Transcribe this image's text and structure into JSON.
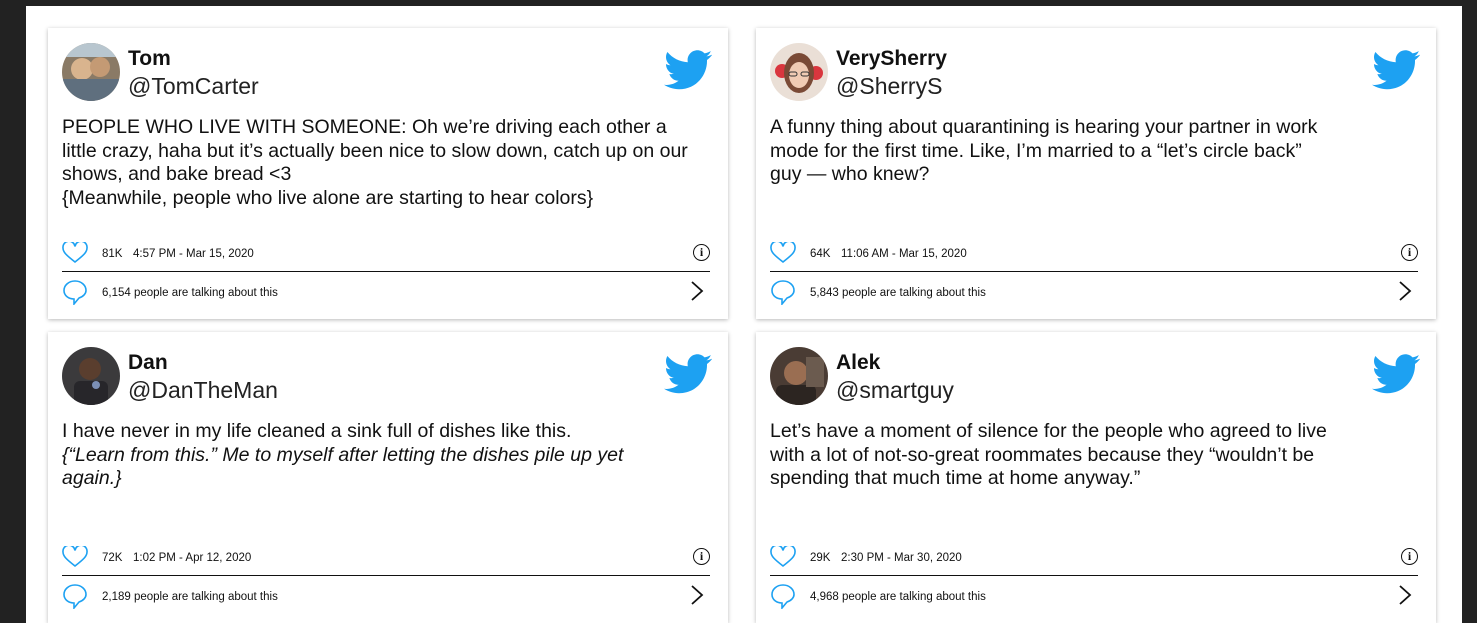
{
  "accent_color": "#1da1f2",
  "icons": {
    "twitter": "twitter-bird-icon",
    "like": "heart-icon",
    "info": "info-icon",
    "reply": "speech-bubble-icon",
    "more": "chevron-right-icon"
  },
  "tweets": [
    {
      "name": "Tom",
      "handle": "@TomCarter",
      "text": "PEOPLE WHO LIVE WITH SOMEONE: Oh we’re driving each other a little crazy, haha but it’s actually been nice to slow down, catch up on our shows, and bake bread <3",
      "text2": "{Meanwhile, people who live alone are starting to hear colors}",
      "likes": "81K",
      "timestamp": "4:57 PM - Mar 15, 2020",
      "talking": "6,154 people are talking about this",
      "info_glyph": "i"
    },
    {
      "name": "VerySherry",
      "handle": "@SherryS",
      "text": "A funny thing about quarantining is hearing your partner in work mode for the first time. Like, I’m married to a “let’s circle back” guy — who knew?",
      "text2": "",
      "likes": "64K",
      "timestamp": "11:06 AM - Mar 15, 2020",
      "talking": "5,843 people are talking about this",
      "info_glyph": "i"
    },
    {
      "name": "Dan",
      "handle": "@DanTheMan",
      "text": "I have never in my life cleaned a sink full of dishes like this.",
      "text2": "{“Learn from this.” Me to myself after letting the dishes pile up yet again.}",
      "likes": "72K",
      "timestamp": "1:02 PM - Apr 12, 2020",
      "talking": "2,189 people are talking about this",
      "info_glyph": "i"
    },
    {
      "name": "Alek",
      "handle": "@smartguy",
      "text": "Let’s have a moment of silence for the people who agreed to live with a lot of not-so-great roommates because they “wouldn’t be spending that much time at home anyway.”",
      "text2": "",
      "likes": "29K",
      "timestamp": "2:30 PM - Mar 30, 2020",
      "talking": "4,968 people are talking about this",
      "info_glyph": "i"
    }
  ]
}
